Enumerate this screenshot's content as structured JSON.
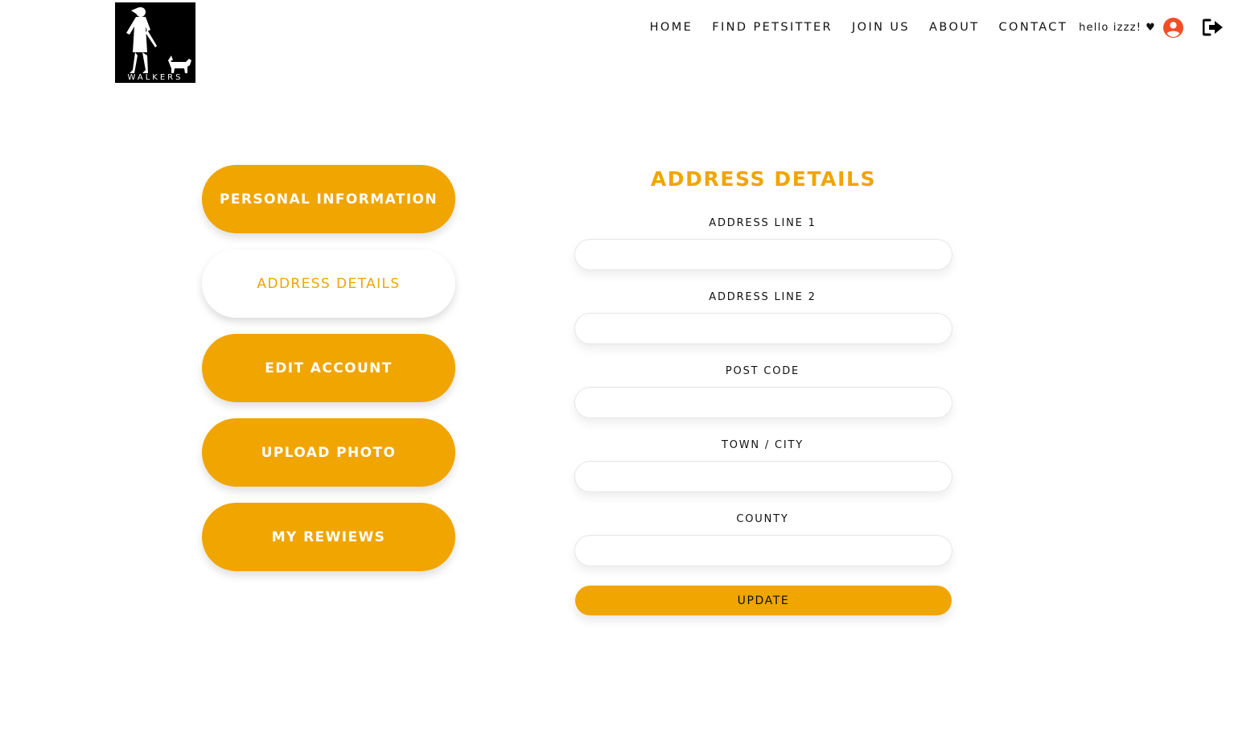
{
  "brand": {
    "logo_text": "WALKERS"
  },
  "nav": {
    "links": [
      "HOME",
      "FIND PETSITTER",
      "JOIN US",
      "ABOUT",
      "CONTACT"
    ],
    "greeting": "hello izzz!",
    "heart": "♥",
    "user_icon": "user-circle-icon",
    "logout_icon": "logout-icon",
    "accent_user_icon": "#f04e23"
  },
  "sidebar": {
    "items": [
      {
        "label": "PERSONAL INFORMATION",
        "active": false
      },
      {
        "label": "ADDRESS DETAILS",
        "active": true
      },
      {
        "label": "EDIT ACCOUNT",
        "active": false
      },
      {
        "label": "UPLOAD PHOTO",
        "active": false
      },
      {
        "label": "MY REWIEWS",
        "active": false
      }
    ]
  },
  "form": {
    "title": "ADDRESS DETAILS",
    "fields": [
      {
        "label": "ADDRESS LINE 1",
        "value": ""
      },
      {
        "label": "ADDRESS LINE 2",
        "value": ""
      },
      {
        "label": "POST CODE",
        "value": ""
      },
      {
        "label": "TOWN / CITY",
        "value": ""
      },
      {
        "label": "COUNTY",
        "value": ""
      }
    ],
    "submit_label": "UPDATE"
  },
  "colors": {
    "accent": "#f0a500",
    "text": "#111111",
    "background": "#ffffff"
  }
}
